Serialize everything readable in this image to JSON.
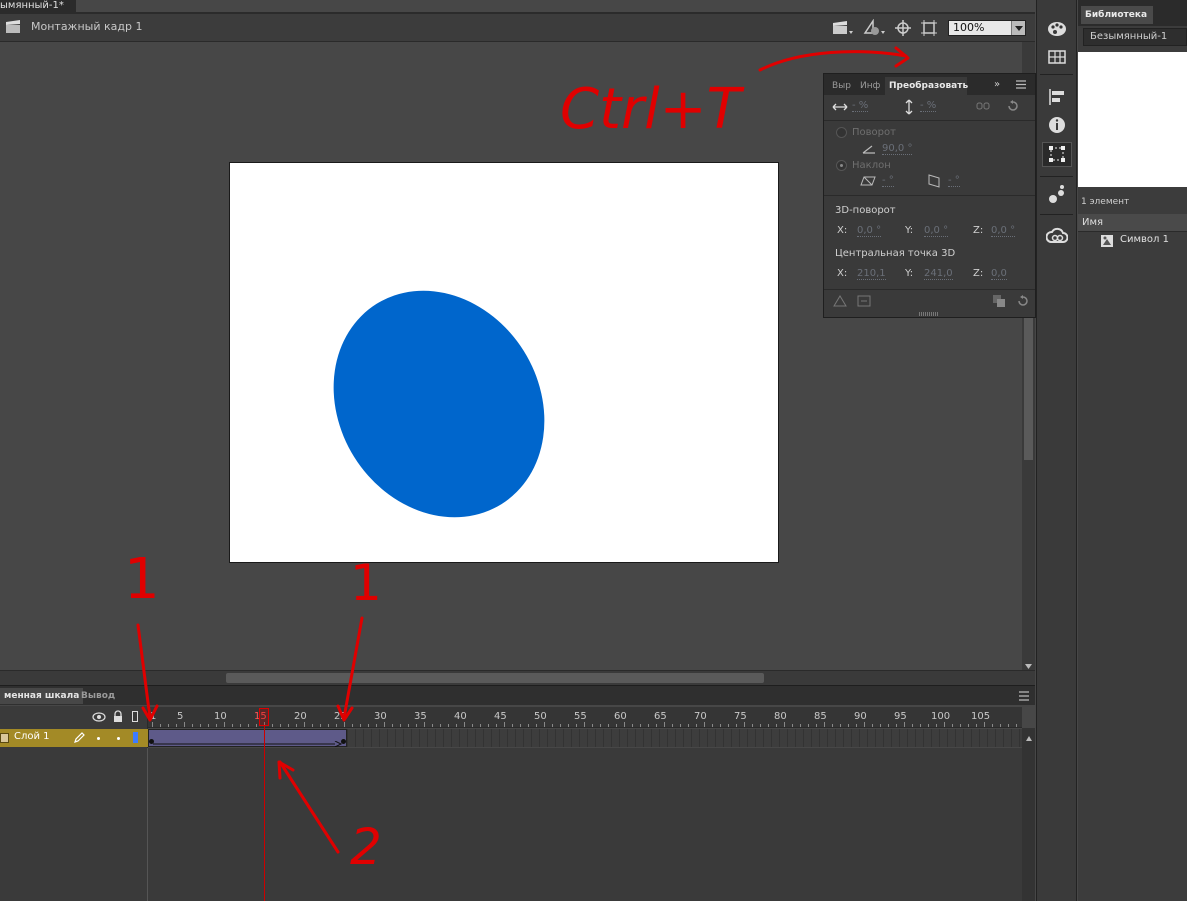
{
  "document": {
    "tab_title": "ымянный-1*",
    "scene_label": "Монтажный кадр 1",
    "zoom": "100%"
  },
  "transform_panel": {
    "tabs": [
      "Выр",
      "Инф",
      "Преобразовать"
    ],
    "width_value": "- %",
    "height_value": "- %",
    "rotate_label": "Поворот",
    "rotate_value": "90,0 °",
    "skew_label": "Наклон",
    "skew_h_value": "- °",
    "skew_v_value": "- °",
    "rotation3d_label": "3D-поворот",
    "rot3d": {
      "x_label": "X:",
      "x": "0,0 °",
      "y_label": "Y:",
      "y": "0,0 °",
      "z_label": "Z:",
      "z": "0,0 °"
    },
    "center3d_label": "Центральная точка 3D",
    "center3d": {
      "x_label": "X:",
      "x": "210,1",
      "y_label": "Y:",
      "y": "241,0",
      "z_label": "Z:",
      "z": "0,0"
    }
  },
  "library": {
    "tab_label": "Библиотека",
    "document_select": "Безымянный-1",
    "count": "1 элемент",
    "column_name": "Имя",
    "items": [
      "Символ 1"
    ]
  },
  "timeline": {
    "tabs": [
      "менная шкала",
      "Вывод"
    ],
    "layer_name": "Слой 1",
    "ruler_ticks": [
      "1",
      "5",
      "10",
      "15",
      "20",
      "25",
      "30",
      "35",
      "40",
      "45",
      "50",
      "55",
      "60",
      "65",
      "70",
      "75",
      "80",
      "85",
      "90",
      "95",
      "100",
      "105"
    ],
    "current_frame": 15,
    "tween_start": 1,
    "tween_end": 25
  },
  "annotations": {
    "shortcut": "Ctrl+T",
    "label_1a": "1",
    "label_1b": "1",
    "label_2": "2"
  },
  "colors": {
    "shape_fill": "#0066CC",
    "annotation": "#FF0000",
    "layer_highlight": "#A38A26",
    "tween": "#5E5A89"
  }
}
